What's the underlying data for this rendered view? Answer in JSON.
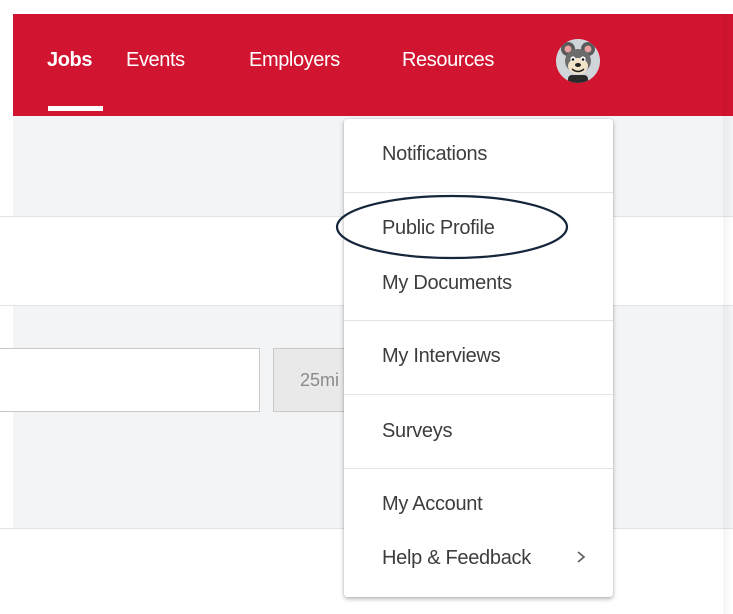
{
  "nav": {
    "items": [
      {
        "label": "Jobs",
        "active": true
      },
      {
        "label": "Events",
        "active": false
      },
      {
        "label": "Employers",
        "active": false
      },
      {
        "label": "Resources",
        "active": false
      }
    ]
  },
  "search": {
    "distance_value": "25mi"
  },
  "menu": {
    "items": [
      {
        "label": "Notifications"
      },
      {
        "label": "Public Profile"
      },
      {
        "label": "My Documents"
      },
      {
        "label": "My Interviews"
      },
      {
        "label": "Surveys"
      },
      {
        "label": "My Account"
      },
      {
        "label": "Help & Feedback",
        "icon": "chevron-right-icon"
      }
    ]
  },
  "colors": {
    "brand": "#d11430",
    "highlight_outline": "#14263a"
  }
}
